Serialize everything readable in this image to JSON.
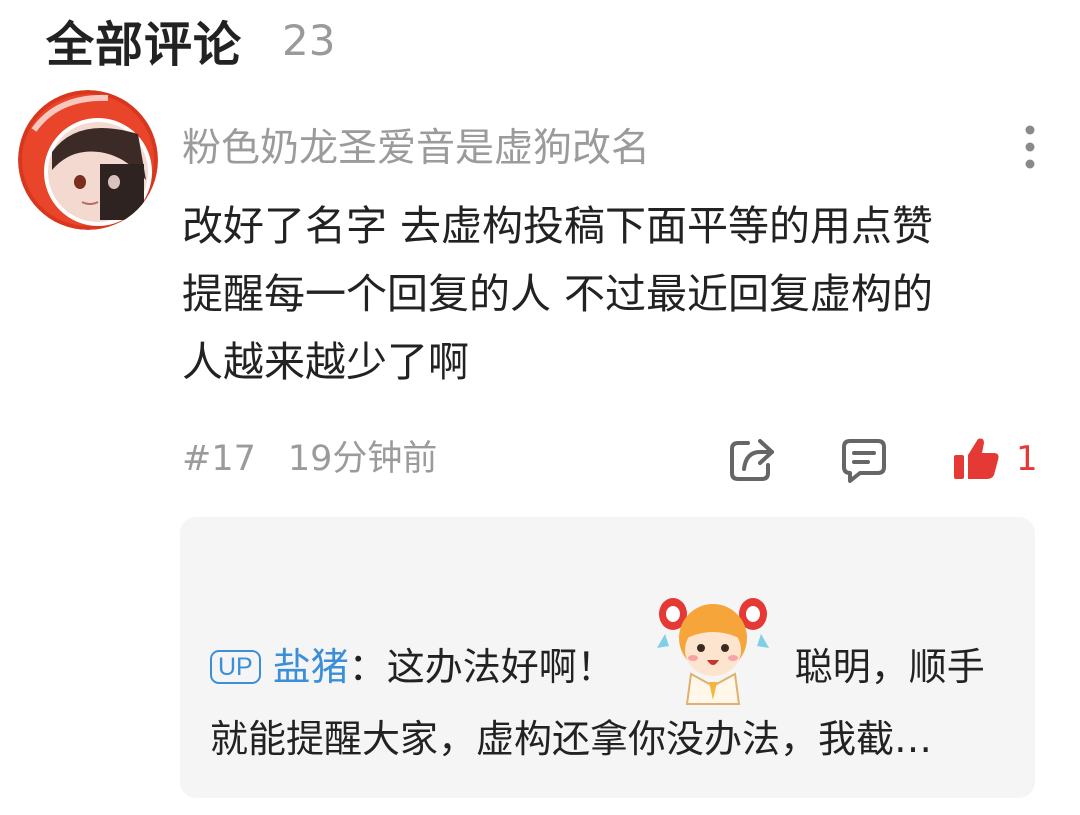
{
  "header": {
    "title": "全部评论",
    "count": "23"
  },
  "comment": {
    "username": "粉色奶龙圣爱音是虚狗改名",
    "text_lines": [
      "改好了名字 去虚构投稿下面平等的用点赞",
      "提醒每一个回复的人 不过最近回复虚构的",
      "人越来越少了啊"
    ],
    "floor": "#17",
    "time": "19分钟前",
    "like_count": "1",
    "icons": [
      "more-vertical-icon",
      "share-icon",
      "reply-icon",
      "like-icon"
    ],
    "like_color": "#e53935"
  },
  "reply": {
    "badge": "UP",
    "user": "盐猪",
    "colon": "：",
    "text_before_emoji": "这办法好啊！",
    "emoji": "anime-girl-sticker",
    "text_after_emoji": "聪明，顺手",
    "line2": "就能提醒大家，虚构还拿你没办法，我截…",
    "accent": "#3b8fd8"
  }
}
